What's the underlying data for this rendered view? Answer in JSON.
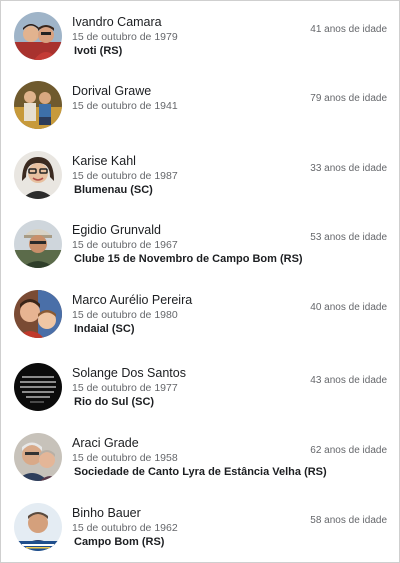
{
  "birthdays": [
    {
      "name": "Ivandro Camara",
      "date": "15 de outubro de 1979",
      "place": "Ivoti (RS)",
      "age": "41 anos de idade",
      "avatar_icon": "profile-photo-two-men"
    },
    {
      "name": "Dorival Grawe",
      "date": "15 de outubro de 1941",
      "place": "",
      "age": "79 anos de idade",
      "avatar_icon": "profile-photo-couple"
    },
    {
      "name": "Karise Kahl",
      "date": "15 de outubro de 1987",
      "place": "Blumenau (SC)",
      "age": "33 anos de idade",
      "avatar_icon": "profile-photo-woman-glasses"
    },
    {
      "name": "Egidio Grunvald",
      "date": "15 de outubro de 1967",
      "place": "Clube 15 de Novembro de Campo Bom (RS)",
      "age": "53 anos de idade",
      "avatar_icon": "profile-photo-man-cap"
    },
    {
      "name": "Marco Aurélio Pereira",
      "date": "15 de outubro de 1980",
      "place": "Indaial (SC)",
      "age": "40 anos de idade",
      "avatar_icon": "profile-photo-man-child"
    },
    {
      "name": "Solange Dos Santos",
      "date": "15 de outubro de 1977",
      "place": "Rio do Sul (SC)",
      "age": "43 anos de idade",
      "avatar_icon": "profile-photo-quote-text"
    },
    {
      "name": "Araci Grade",
      "date": "15 de outubro de 1958",
      "place": "Sociedade de Canto Lyra de Estância Velha (RS)",
      "age": "62 anos de idade",
      "avatar_icon": "profile-photo-couple-selfie"
    },
    {
      "name": "Binho Bauer",
      "date": "15 de outubro de 1962",
      "place": "Campo Bom (RS)",
      "age": "58 anos de idade",
      "avatar_icon": "profile-photo-man-banner"
    }
  ]
}
